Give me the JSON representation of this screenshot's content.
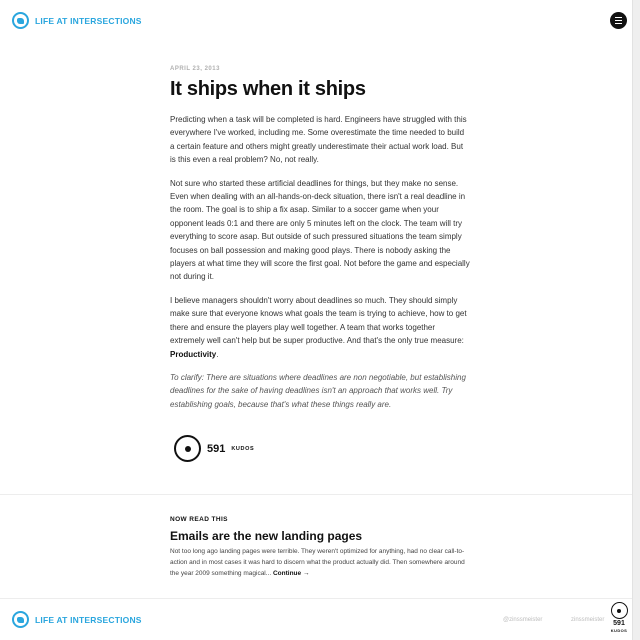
{
  "header": {
    "brand": "LIFE AT INTERSECTIONS",
    "menu_icon": "hamburger-menu-icon"
  },
  "article": {
    "date": "APRIL 23, 2013",
    "title": "It ships when it ships",
    "paragraphs": [
      "Predicting when a task will be completed is hard. Engineers have struggled with this everywhere I've worked, including me. Some overestimate the time needed to build a certain feature and others might greatly underestimate their actual work load. But is this even a real problem? No, not really.",
      "Not sure who started these artificial deadlines for things, but they make no sense. Even when dealing with an all-hands-on-deck situation, there isn't a real deadline in the room. The goal is to ship a fix asap. Similar to a soccer game when your opponent leads 0:1 and there are only 5 minutes left on the clock. The team will try everything to score asap. But outside of such pressured situations the team simply focuses on ball possession and making good plays. There is nobody asking the players at what time they will score the first goal. Not before the game and especially not during it.",
      "I believe managers shouldn't worry about deadlines so much. They should simply make sure that everyone knows what goals the team is trying to achieve, how to get there and ensure the players play well together. A team that works together extremely well can't help but be super productive. And that's the only true measure:"
    ],
    "emphasis": "Productivity",
    "emphasis_suffix": ".",
    "closing": "To clarify: There are situations where deadlines are non negotiable, but establishing deadlines for the sake of having deadlines isn't an approach that works well. Try establishing goals, because that's what these things really are."
  },
  "kudos": {
    "count": "591",
    "label": "KUDOS"
  },
  "next": {
    "label": "NOW READ THIS",
    "title": "Emails are the new landing pages",
    "excerpt": "Not too long ago landing pages were terrible. They weren't optimized for anything, had no clear call-to-action and in most cases it was hard to discern what the product actually did. Then somewhere around the year 2009 something magical...",
    "continue": "Continue →"
  },
  "footer": {
    "brand": "LIFE AT INTERSECTIONS",
    "handle_1": "@zinssmeister",
    "handle_2": "zinssmeister",
    "kudos_count": "591",
    "kudos_label": "KUDOS"
  },
  "colors": {
    "brand": "#2aa6de",
    "text": "#333333",
    "muted": "#b0b0b0"
  }
}
